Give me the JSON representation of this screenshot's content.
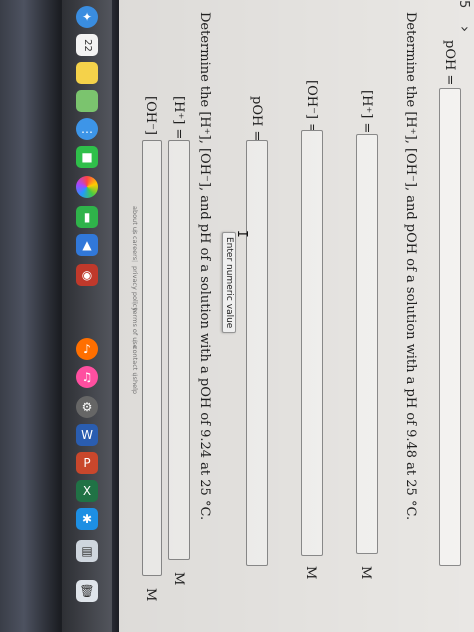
{
  "nav": {
    "question_number": "5",
    "next_chevron": "›"
  },
  "q1": {
    "poh_label": "pOH =",
    "prompt": "Determine the [H⁺], [OH⁻], and pOH of a solution with a pH of 9.48 at 25 °C.",
    "h_label": "[H⁺] =",
    "oh_label": "[OH⁻] =",
    "poh2_label": "pOH =",
    "unit": "M"
  },
  "q2": {
    "prompt": "Determine the [H⁺], [OH⁻], and pH of a solution with a pOH of 9.24 at 25 °C.",
    "h_label": "[H⁺] =",
    "oh_label": "[OH⁻] =",
    "unit": "M"
  },
  "tooltip": "Enter numeric value",
  "footer": {
    "links": [
      "about us",
      "careers",
      "privacy policy",
      "terms of use",
      "contact us",
      "help"
    ]
  },
  "dock": {
    "calendar_day": "22",
    "icons": [
      "finder-icon",
      "safari-icon",
      "calendar-icon",
      "notes-icon",
      "maps-icon",
      "messages-icon",
      "facetime-icon",
      "photos-icon",
      "numbers-icon",
      "keynote-icon",
      "photo-booth-icon",
      "itunes-icon",
      "system-preferences-icon",
      "word-icon",
      "powerpoint-icon",
      "excel-icon",
      "app-store-icon",
      "preview-icon",
      "trash-icon"
    ]
  },
  "colors": {
    "page_bg": "#e9e7e4",
    "input_border": "#8b8b8b",
    "bezel": "#2a2c34"
  }
}
